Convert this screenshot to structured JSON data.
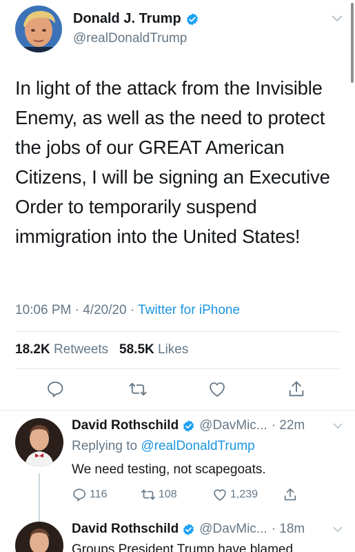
{
  "tweet": {
    "display_name": "Donald J. Trump",
    "handle": "@realDonaldTrump",
    "text": "In light of the attack from the Invisible Enemy, as well as the need to protect the jobs of our GREAT American Citizens, I will be signing an Executive Order to temporarily suspend immigration into the United States!",
    "time": "10:06 PM",
    "date": "4/20/20",
    "separator": "·",
    "source": "Twitter for iPhone",
    "retweets_count": "18.2K",
    "retweets_label": "Retweets",
    "likes_count": "58.5K",
    "likes_label": "Likes"
  },
  "replies": [
    {
      "display_name": "David Rothschild",
      "handle": "@DavMic...",
      "time": "· 22m",
      "replying_prefix": "Replying to",
      "replying_to": "@realDonaldTrump",
      "text": "We need testing, not scapegoats.",
      "reply_count": "116",
      "retweet_count": "108",
      "like_count": "1,239"
    },
    {
      "display_name": "David Rothschild",
      "handle": "@DavMic...",
      "time": "· 18m",
      "text": "Groups President Trump have blamed"
    }
  ],
  "colors": {
    "verified": "#1da1f2",
    "link": "#1b95e0",
    "muted": "#657786",
    "text": "#14171a"
  },
  "icons": {
    "reply": "speech-bubble-icon",
    "retweet": "retweet-arrows-icon",
    "like": "heart-icon",
    "share": "share-upload-icon",
    "verified": "verified-badge-icon",
    "caret": "chevron-down-icon"
  }
}
